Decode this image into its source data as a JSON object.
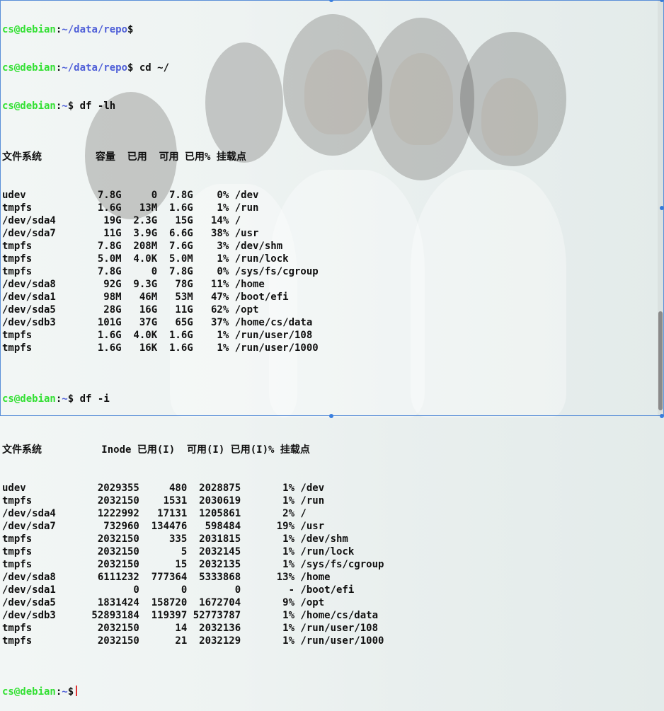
{
  "terminal": {
    "prompts": [
      {
        "user": "cs@debian",
        "path": "~/data/repo",
        "sign": "$",
        "command": ""
      },
      {
        "user": "cs@debian",
        "path": "~/data/repo",
        "sign": "$",
        "command": " cd ~/"
      },
      {
        "user": "cs@debian",
        "path": "~",
        "sign": "$",
        "command": " df -lh"
      }
    ],
    "df_lh_header": "文件系统         容量  已用  可用 已用% 挂载点",
    "df_lh_rows": [
      "udev            7.8G     0  7.8G    0% /dev",
      "tmpfs           1.6G   13M  1.6G    1% /run",
      "/dev/sda4        19G  2.3G   15G   14% /",
      "/dev/sda7        11G  3.9G  6.6G   38% /usr",
      "tmpfs           7.8G  208M  7.6G    3% /dev/shm",
      "tmpfs           5.0M  4.0K  5.0M    1% /run/lock",
      "tmpfs           7.8G     0  7.8G    0% /sys/fs/cgroup",
      "/dev/sda8        92G  9.3G   78G   11% /home",
      "/dev/sda1        98M   46M   53M   47% /boot/efi",
      "/dev/sda5        28G   16G   11G   62% /opt",
      "/dev/sdb3       101G   37G   65G   37% /home/cs/data",
      "tmpfs           1.6G  4.0K  1.6G    1% /run/user/108",
      "tmpfs           1.6G   16K  1.6G    1% /run/user/1000"
    ],
    "prompt_dfi": {
      "user": "cs@debian",
      "path": "~",
      "sign": "$",
      "command": " df -i"
    },
    "df_i_header": "文件系统          Inode 已用(I)  可用(I) 已用(I)% 挂载点",
    "df_i_rows": [
      "udev            2029355     480  2028875       1% /dev",
      "tmpfs           2032150    1531  2030619       1% /run",
      "/dev/sda4       1222992   17131  1205861       2% /",
      "/dev/sda7        732960  134476   598484      19% /usr",
      "tmpfs           2032150     335  2031815       1% /dev/shm",
      "tmpfs           2032150       5  2032145       1% /run/lock",
      "tmpfs           2032150      15  2032135       1% /sys/fs/cgroup",
      "/dev/sda8       6111232  777364  5333868      13% /home",
      "/dev/sda1             0       0        0        - /boot/efi",
      "/dev/sda5       1831424  158720  1672704       9% /opt",
      "/dev/sdb3      52893184  119397 52773787       1% /home/cs/data",
      "tmpfs           2032150      14  2032136       1% /run/user/108",
      "tmpfs           2032150      21  2032129       1% /run/user/1000"
    ],
    "prompt_last": {
      "user": "cs@debian",
      "path": "~",
      "sign": "$",
      "command": " "
    }
  },
  "colors": {
    "prompt_user": "#33e033",
    "prompt_path": "#4f5fd8",
    "text": "#101010",
    "cursor": "#e03030",
    "frame": "#5a8fd8"
  }
}
